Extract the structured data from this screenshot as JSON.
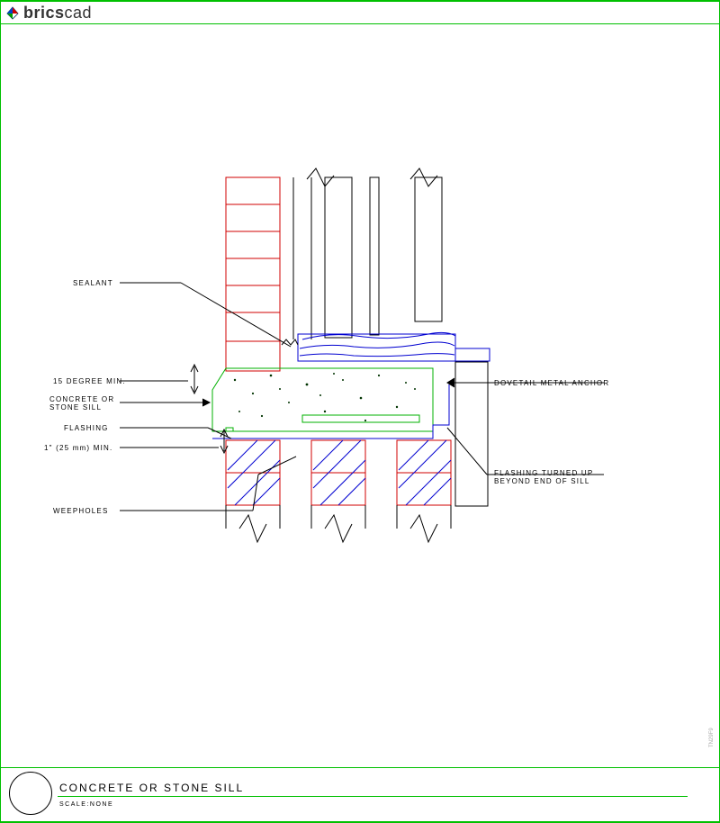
{
  "header": {
    "logo_text_bold": "brics",
    "logo_text_rest": "cad"
  },
  "labels": {
    "sealant": "SEALANT",
    "degree": "15 DEGREE MIN.",
    "concrete": "CONCRETE OR\nSTONE SILL",
    "flashing": "FLASHING",
    "onein": "1\" (25 mm) MIN.",
    "weepholes": "WEEPHOLES",
    "dovetail": "DOVETAIL METAL ANCHOR",
    "flashturned": "FLASHING TURNED UP\nBEYOND END OF SILL"
  },
  "footer": {
    "title": "CONCRETE OR STONE SILL",
    "scale": "SCALE:NONE"
  },
  "side": "TN29F9"
}
